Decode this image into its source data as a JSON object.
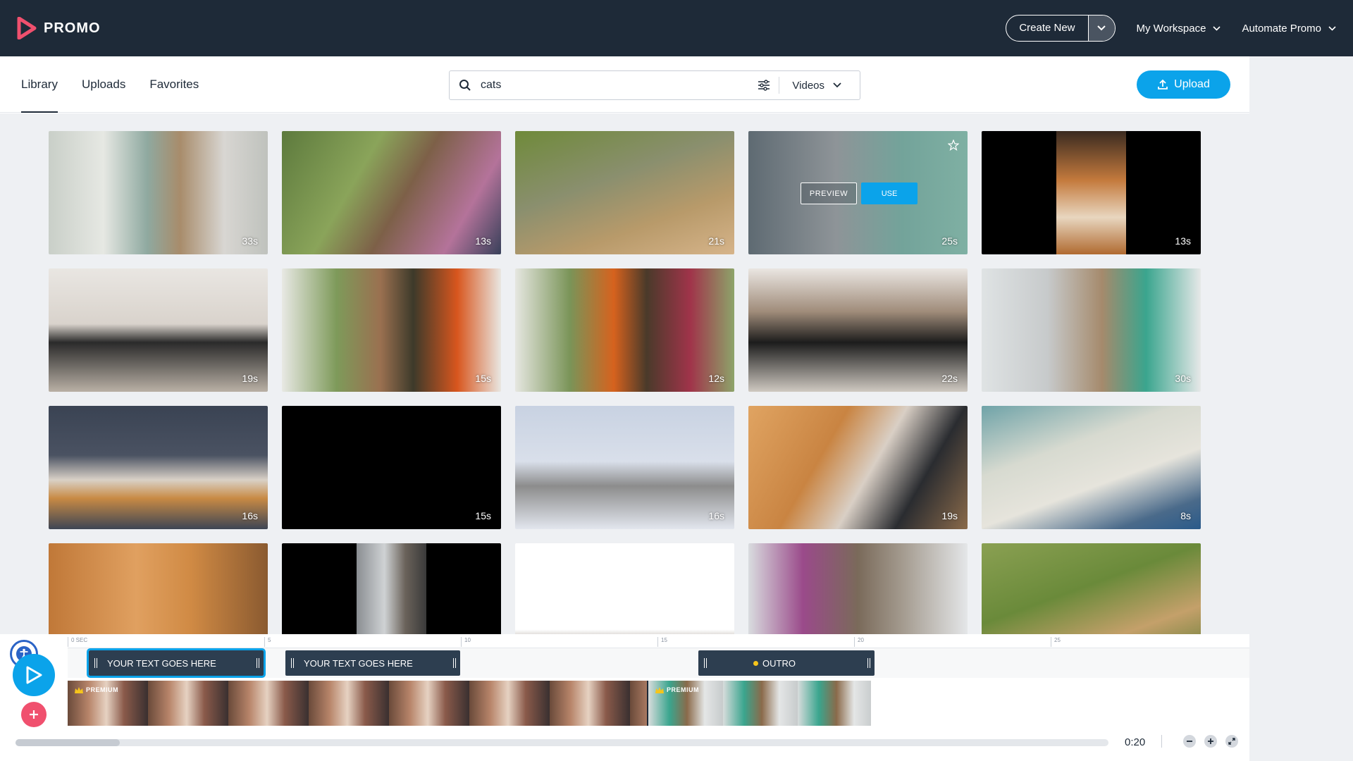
{
  "brand": {
    "name": "PROMO",
    "accent": "#0ba3ea",
    "logo_color": "#f0506e"
  },
  "topbar": {
    "create_new_label": "Create New",
    "workspace_label": "My Workspace",
    "automate_label": "Automate Promo"
  },
  "tabs": [
    {
      "label": "Library",
      "active": true
    },
    {
      "label": "Uploads",
      "active": false
    },
    {
      "label": "Favorites",
      "active": false
    }
  ],
  "search": {
    "value": "cats",
    "media_type": "Videos"
  },
  "upload_label": "Upload",
  "hover_tile": {
    "preview_label": "PREVIEW",
    "use_label": "USE"
  },
  "tiles": [
    {
      "duration": "33s"
    },
    {
      "duration": "13s"
    },
    {
      "duration": "21s"
    },
    {
      "duration": "25s"
    },
    {
      "duration": "13s"
    },
    {
      "duration": "19s"
    },
    {
      "duration": "15s"
    },
    {
      "duration": "12s"
    },
    {
      "duration": "22s"
    },
    {
      "duration": "30s"
    },
    {
      "duration": "16s"
    },
    {
      "duration": "15s"
    },
    {
      "duration": "16s"
    },
    {
      "duration": "19s"
    },
    {
      "duration": "8s"
    },
    {
      "duration": ""
    },
    {
      "duration": ""
    },
    {
      "duration": ""
    },
    {
      "duration": ""
    },
    {
      "duration": ""
    }
  ],
  "timeline": {
    "ticks": [
      "0 SEC",
      "5",
      "10",
      "15",
      "20",
      "25"
    ],
    "text_clips": [
      {
        "label": "YOUR TEXT GOES HERE"
      },
      {
        "label": "YOUR TEXT GOES HERE"
      },
      {
        "label": "OUTRO"
      }
    ],
    "premium_label": "PREMIUM",
    "time": "0:20"
  }
}
